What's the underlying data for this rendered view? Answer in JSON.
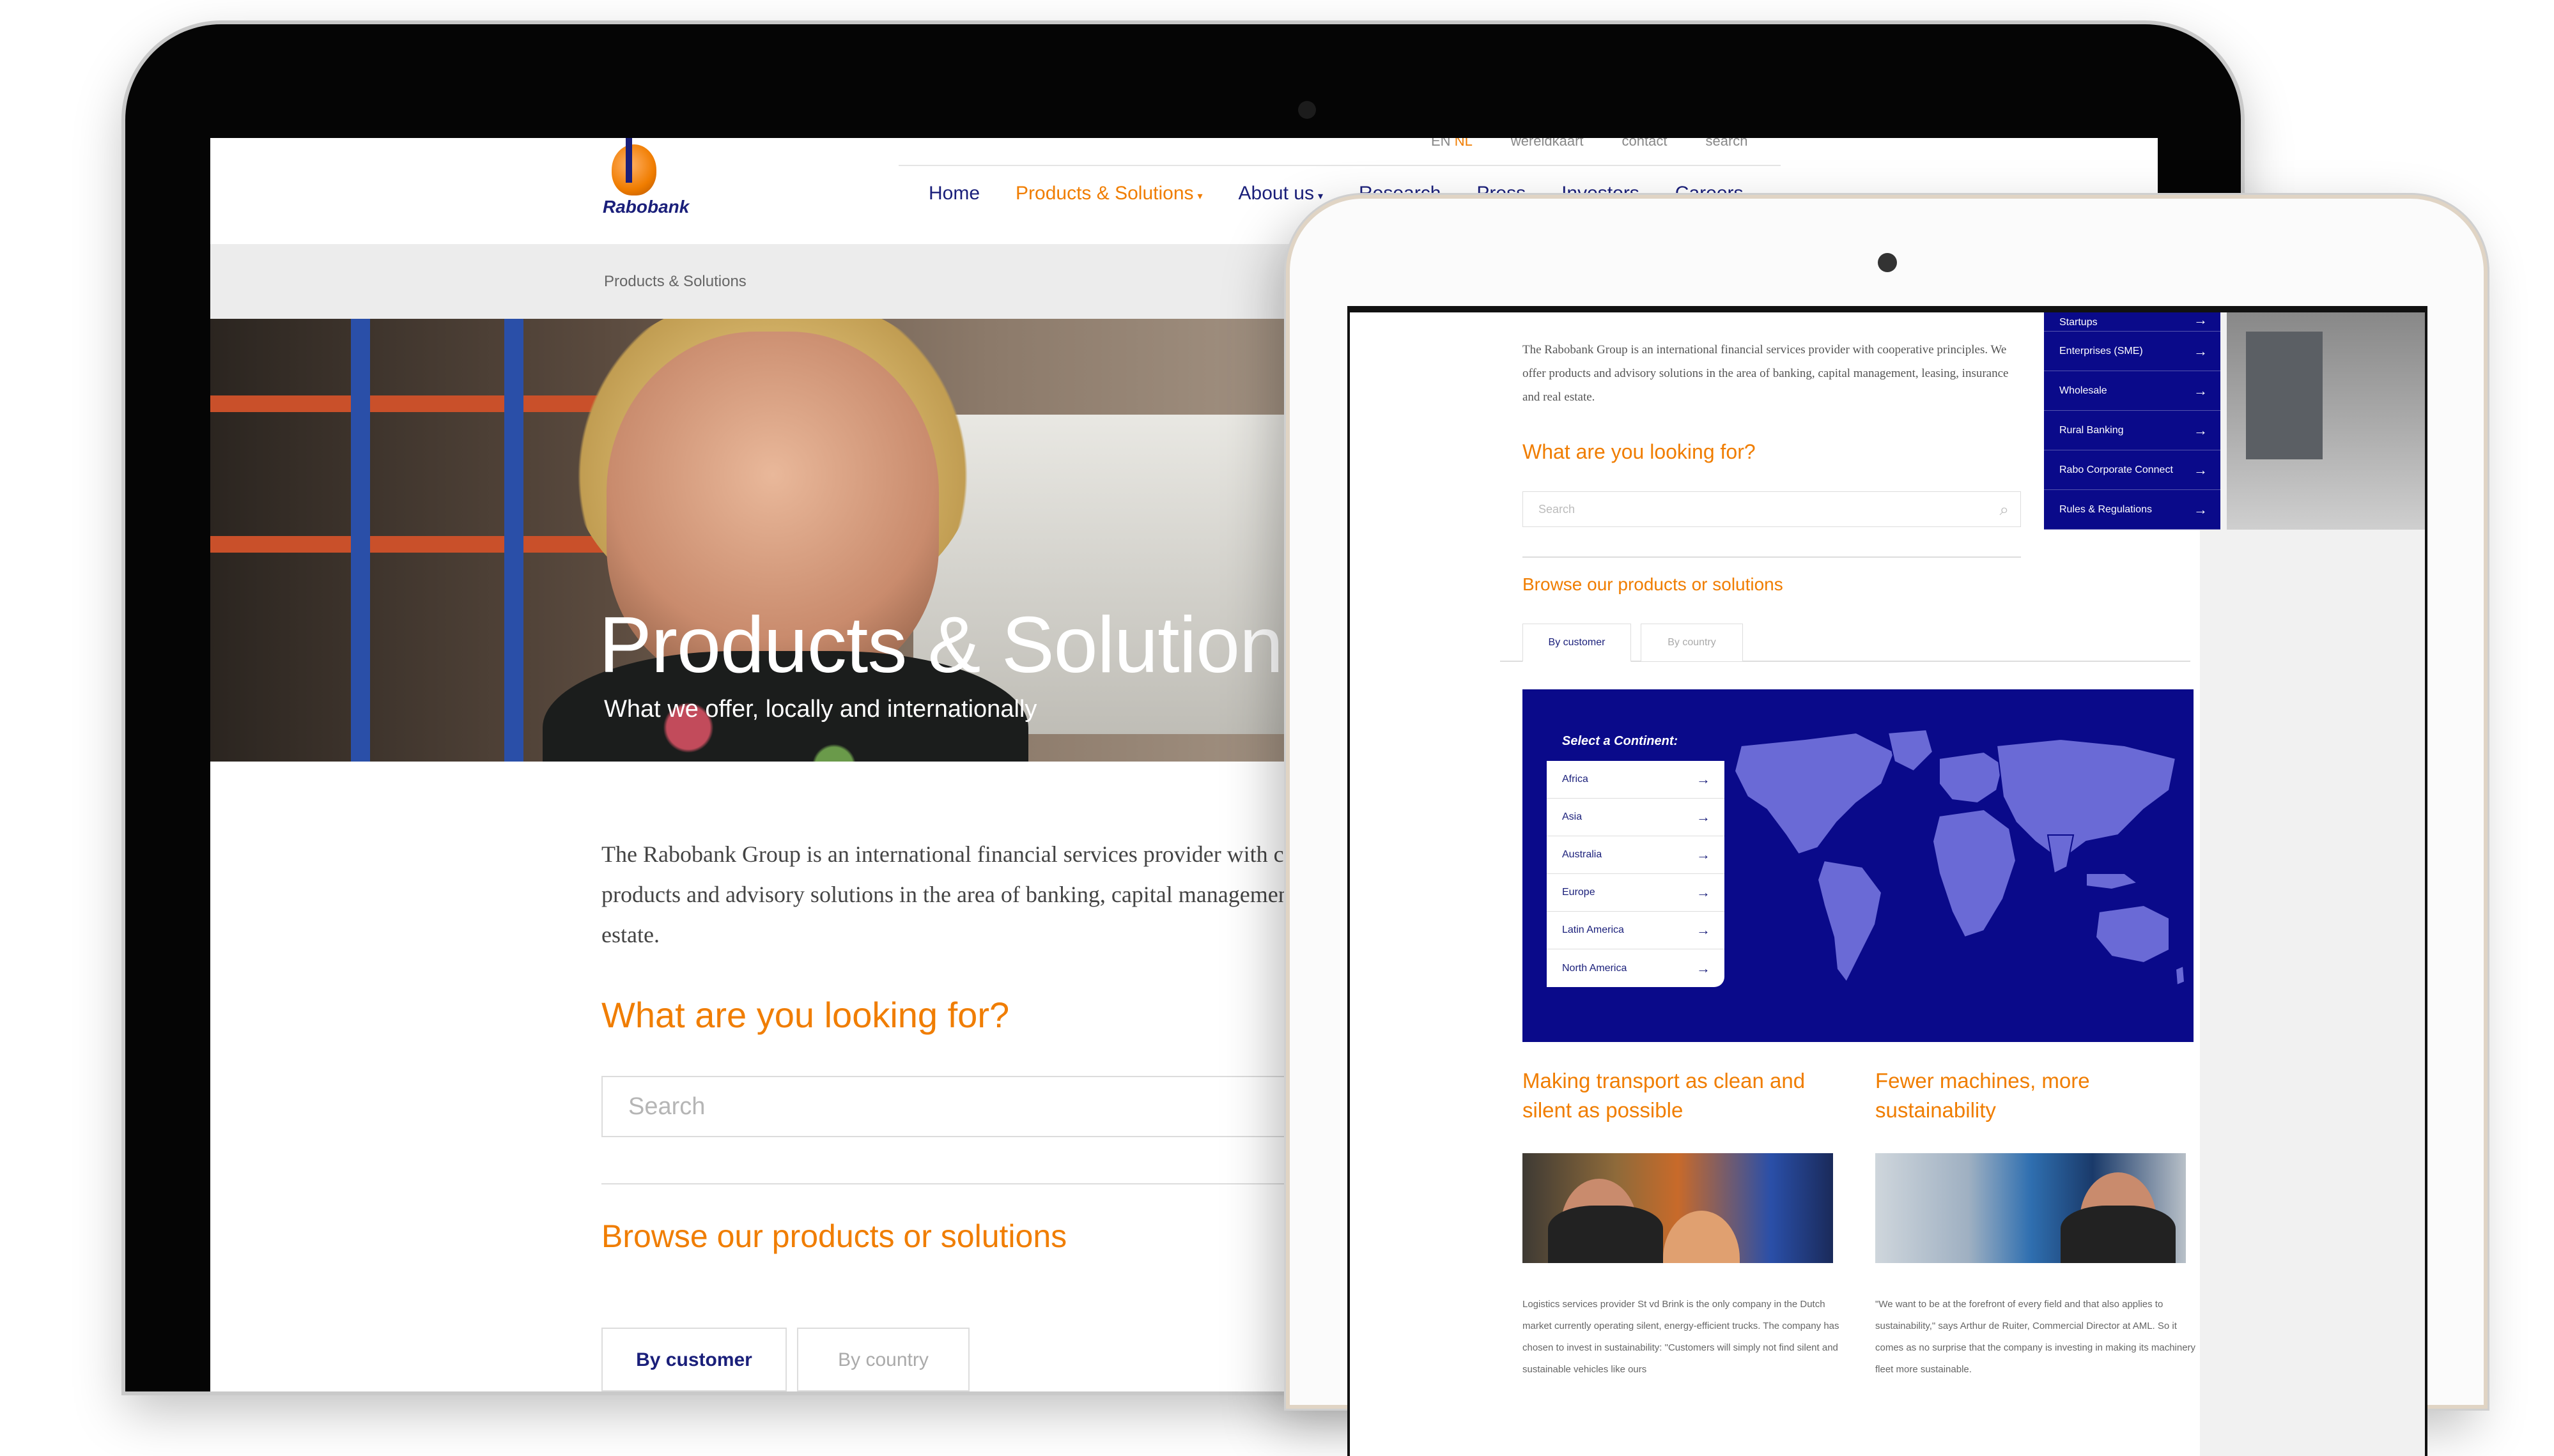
{
  "desktop": {
    "utility_nav": {
      "lang_en": "EN",
      "lang_nl": "NL",
      "map": "wereldkaart",
      "contact": "contact",
      "search": "search"
    },
    "logo_text": "Rabobank",
    "main_nav": [
      "Home",
      "Products & Solutions",
      "About us",
      "Research",
      "Press",
      "Investors",
      "Careers"
    ],
    "breadcrumb": "Products & Solutions",
    "hero": {
      "title": "Products & Solutions",
      "subtitle": "What we offer, locally and internationally"
    },
    "intro": "The Rabobank Group is an international financial services provider with cooperative principles. We offer products and advisory solutions in the area of banking, capital management, leasing, insurance and real estate.",
    "question": "What are you looking for?",
    "search_placeholder": "Search",
    "browse": "Browse our products or solutions",
    "tabs": [
      "By customer",
      "By country"
    ]
  },
  "tablet": {
    "sub_menu": [
      "Startups",
      "Enterprises (SME)",
      "Wholesale",
      "Rural Banking",
      "Rabo Corporate Connect",
      "Rules & Regulations"
    ],
    "intro": "The Rabobank Group is an international financial services provider with cooperative principles. We offer products and advisory solutions in the area of banking, capital management, leasing, insurance and real estate.",
    "question": "What are you looking for?",
    "search_placeholder": "Search",
    "browse": "Browse our products or solutions",
    "tabs": [
      "By customer",
      "By country"
    ],
    "continent_heading": "Select a Continent:",
    "continents": [
      "Africa",
      "Asia",
      "Australia",
      "Europe",
      "Latin America",
      "North America"
    ],
    "stories": [
      {
        "title": "Making transport as clean and silent as possible",
        "text": "Logistics services provider St vd Brink is the only company in the Dutch market currently operating silent, energy-efficient trucks. The company has chosen to invest in sustainability: \"Customers will simply not find silent and sustainable vehicles like ours"
      },
      {
        "title": "Fewer machines, more sustainability",
        "text": "\"We want to be at the forefront of every field and that also applies to sustainability,\" says Arthur de Ruiter, Commercial Director at AML. So it comes as no surprise that the company is investing in making its machinery fleet more sustainable."
      }
    ]
  },
  "colors": {
    "brand_blue": "#0a0a8a",
    "brand_orange": "#f07d00",
    "map_land": "#6a6ad6"
  },
  "icons": [
    "arrow-right-icon",
    "search-icon",
    "chevron-down-icon",
    "world-map-icon"
  ]
}
